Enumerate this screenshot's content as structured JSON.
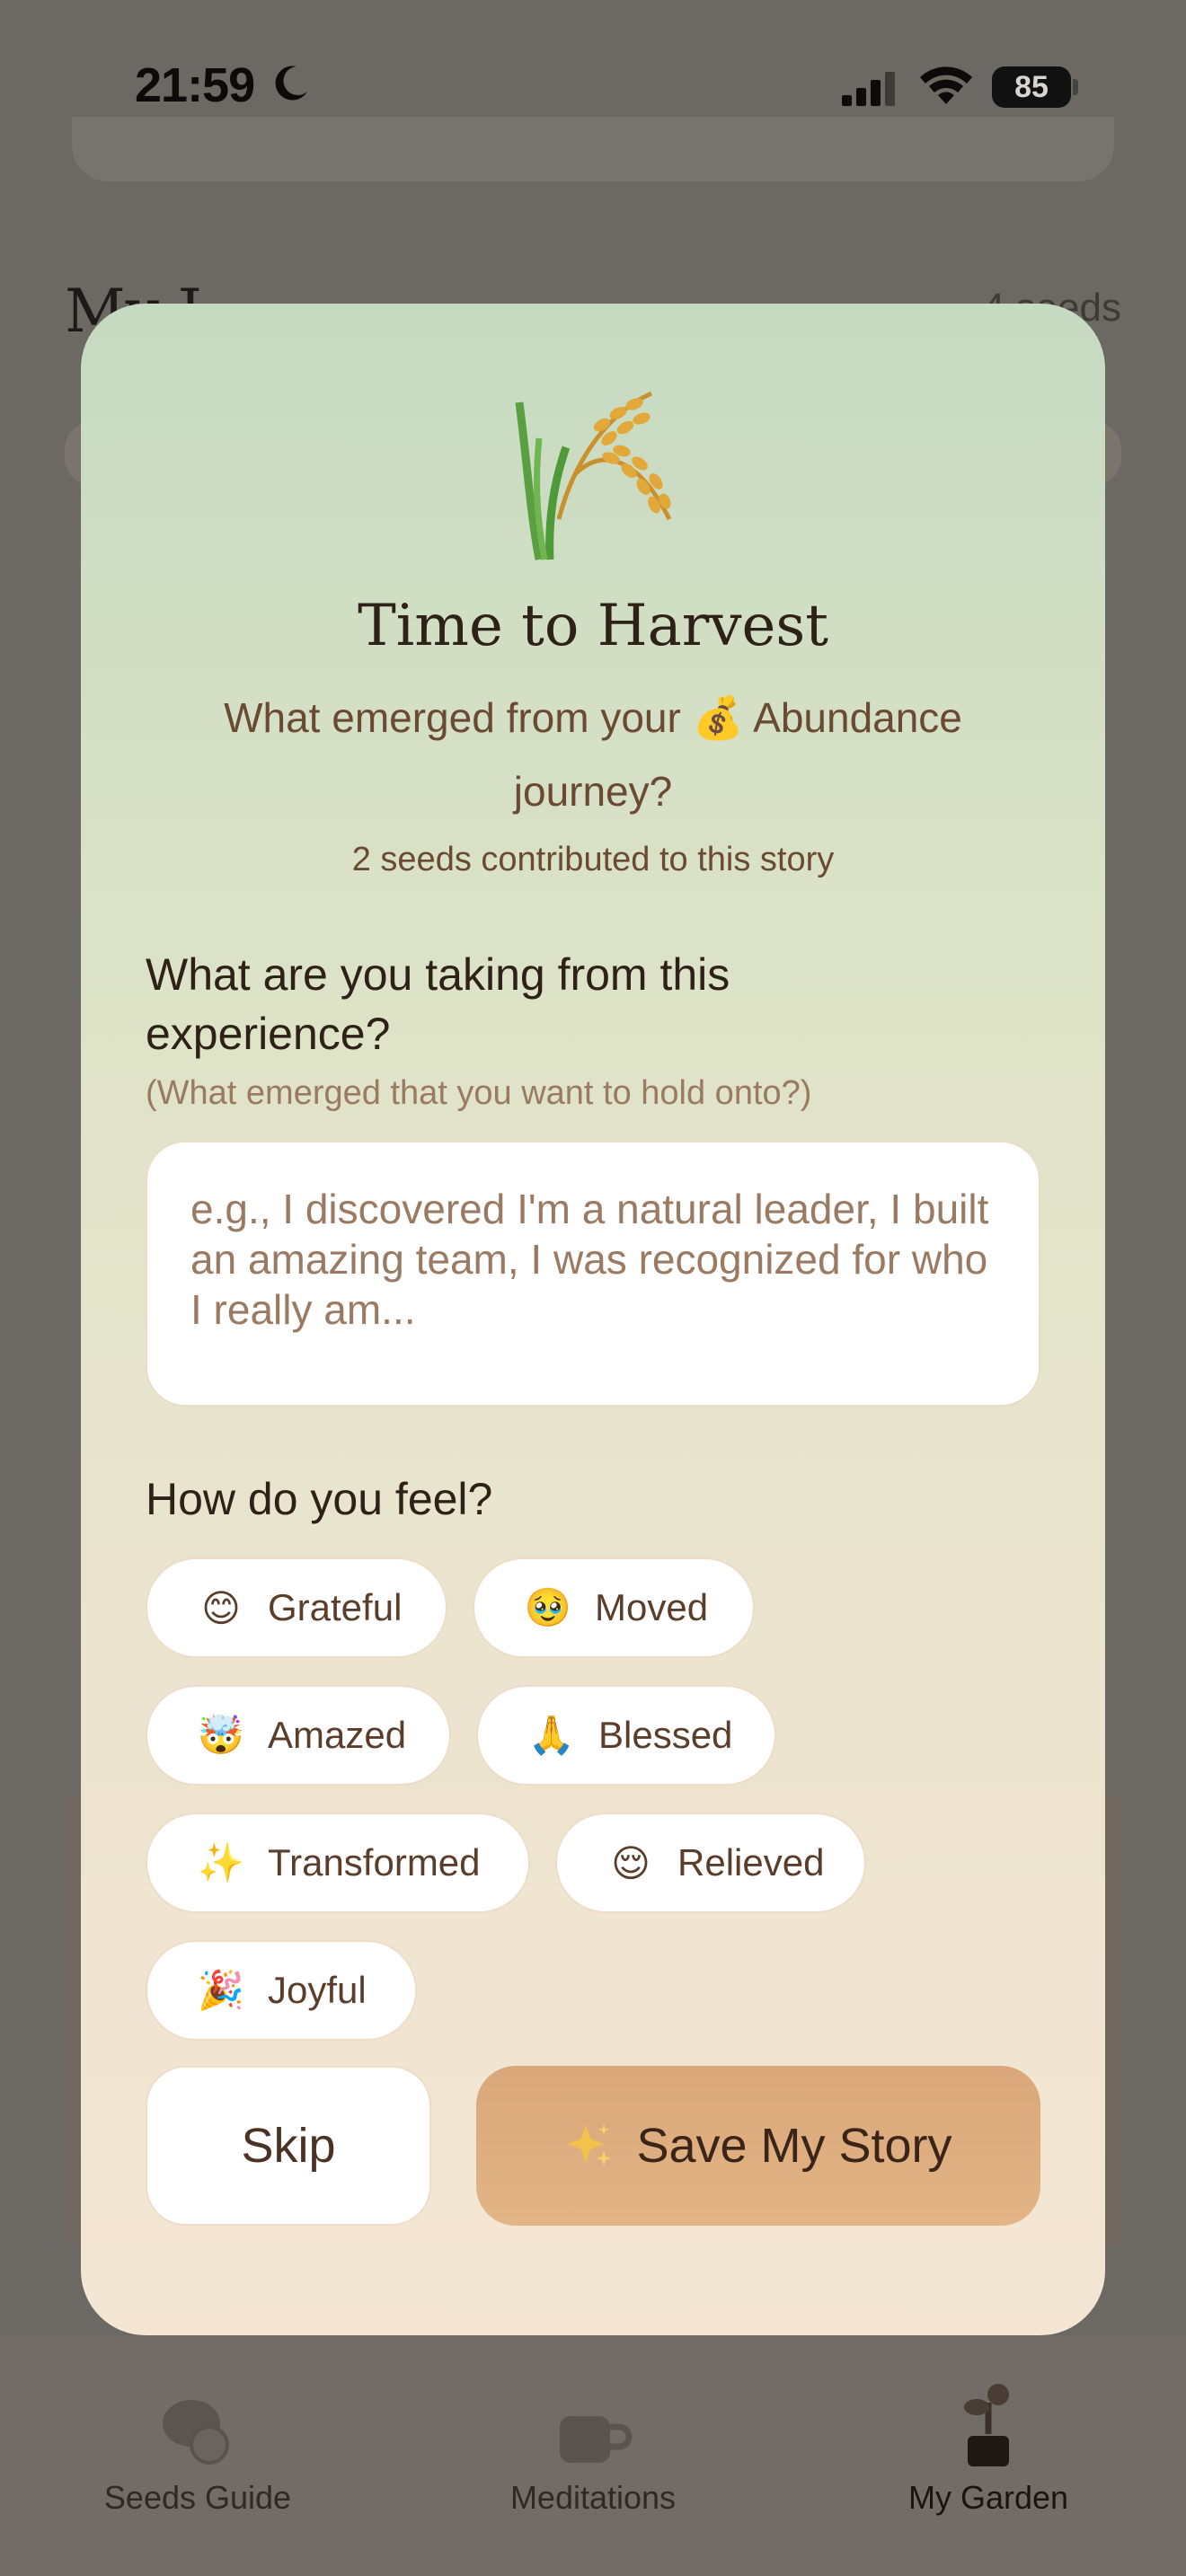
{
  "status_bar": {
    "time": "21:59",
    "battery": "85"
  },
  "background": {
    "heading": "My J",
    "count": "4 seeds"
  },
  "modal": {
    "title": "Time to Harvest",
    "subtitle": "What emerged from your 💰 Abundance journey?",
    "seeds_note": "2 seeds contributed to this story",
    "question": "What are you taking from this experience?",
    "question_hint": "(What emerged that you want to hold onto?)",
    "input_placeholder": "e.g., I discovered I'm a natural leader, I built an amazing team, I was recognized for who I really am...",
    "input_value": "",
    "feel_heading": "How do you feel?",
    "feelings": [
      {
        "emoji": "😊",
        "label": "Grateful",
        "icon": "smiling-face-icon"
      },
      {
        "emoji": "🥹",
        "label": "Moved",
        "icon": "holding-back-tears-icon"
      },
      {
        "emoji": "🤯",
        "label": "Amazed",
        "icon": "mind-blown-icon"
      },
      {
        "emoji": "🙏",
        "label": "Blessed",
        "icon": "folded-hands-icon"
      },
      {
        "emoji": "✨",
        "label": "Transformed",
        "icon": "sparkles-icon"
      },
      {
        "emoji": "😌",
        "label": "Relieved",
        "icon": "relieved-face-icon"
      },
      {
        "emoji": "🎉",
        "label": "Joyful",
        "icon": "party-popper-icon"
      }
    ],
    "skip_label": "Skip",
    "save_label": "Save My Story"
  },
  "tabs": [
    {
      "label": "Seeds Guide",
      "icon": "seeds-icon"
    },
    {
      "label": "Meditations",
      "icon": "cup-icon"
    },
    {
      "label": "My Garden",
      "icon": "plant-pot-icon"
    }
  ],
  "colors": {
    "accent": "#dfae80",
    "text_dark": "#2e2118",
    "text_brown": "#6b4a33",
    "modal_top": "#c6dac1",
    "modal_bottom": "#f5e6d4"
  }
}
